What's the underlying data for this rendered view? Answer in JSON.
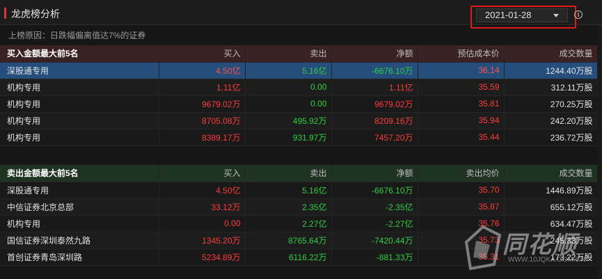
{
  "header": {
    "title": "龙虎榜分析",
    "date": "2021-01-28",
    "info_glyph": "i"
  },
  "reason": "上榜原因：日跌幅偏离值达7%的证券",
  "buy_table": {
    "columns": [
      "买入金额最大前5名",
      "买入",
      "卖出",
      "净额",
      "预估成本价",
      "成交数量"
    ],
    "rows": [
      {
        "name": "深股通专用",
        "buy": "4.50亿",
        "sell": "5.16亿",
        "net": "-6676.10万",
        "price": "36.14",
        "volume": "1244.40万股",
        "net_color": "green"
      },
      {
        "name": "机构专用",
        "buy": "1.11亿",
        "sell": "0.00",
        "net": "1.11亿",
        "price": "35.59",
        "volume": "312.11万股",
        "net_color": "red"
      },
      {
        "name": "机构专用",
        "buy": "9679.02万",
        "sell": "0.00",
        "net": "9679.02万",
        "price": "35.81",
        "volume": "270.25万股",
        "net_color": "red"
      },
      {
        "name": "机构专用",
        "buy": "8705.08万",
        "sell": "495.92万",
        "net": "8209.16万",
        "price": "35.94",
        "volume": "242.20万股",
        "net_color": "red"
      },
      {
        "name": "机构专用",
        "buy": "8389.17万",
        "sell": "931.97万",
        "net": "7457.20万",
        "price": "35.44",
        "volume": "236.72万股",
        "net_color": "red"
      }
    ]
  },
  "sell_table": {
    "columns": [
      "卖出金额最大前5名",
      "买入",
      "卖出",
      "净额",
      "卖出均价",
      "成交数量"
    ],
    "rows": [
      {
        "name": "深股通专用",
        "buy": "4.50亿",
        "sell": "5.16亿",
        "net": "-6676.10万",
        "price": "35.70",
        "volume": "1446.89万股",
        "net_color": "green"
      },
      {
        "name": "中信证券北京总部",
        "buy": "33.12万",
        "sell": "2.35亿",
        "net": "-2.35亿",
        "price": "35.87",
        "volume": "655.12万股",
        "net_color": "green"
      },
      {
        "name": "机构专用",
        "buy": "0.00",
        "sell": "2.27亿",
        "net": "-2.27亿",
        "price": "35.76",
        "volume": "634.47万股",
        "net_color": "green"
      },
      {
        "name": "国信证券深圳泰然九路",
        "buy": "1345.20万",
        "sell": "8765.64万",
        "net": "-7420.44万",
        "price": "35.73",
        "volume": "245.33万股",
        "net_color": "green"
      },
      {
        "name": "首创证券青岛深圳路",
        "buy": "5234.89万",
        "sell": "6116.22万",
        "net": "-881.33万",
        "price": "35.31",
        "volume": "173.22万股",
        "net_color": "green"
      }
    ]
  },
  "watermark": {
    "text": "同花顺",
    "url": "WWW.10JQKA.COM.CN"
  }
}
